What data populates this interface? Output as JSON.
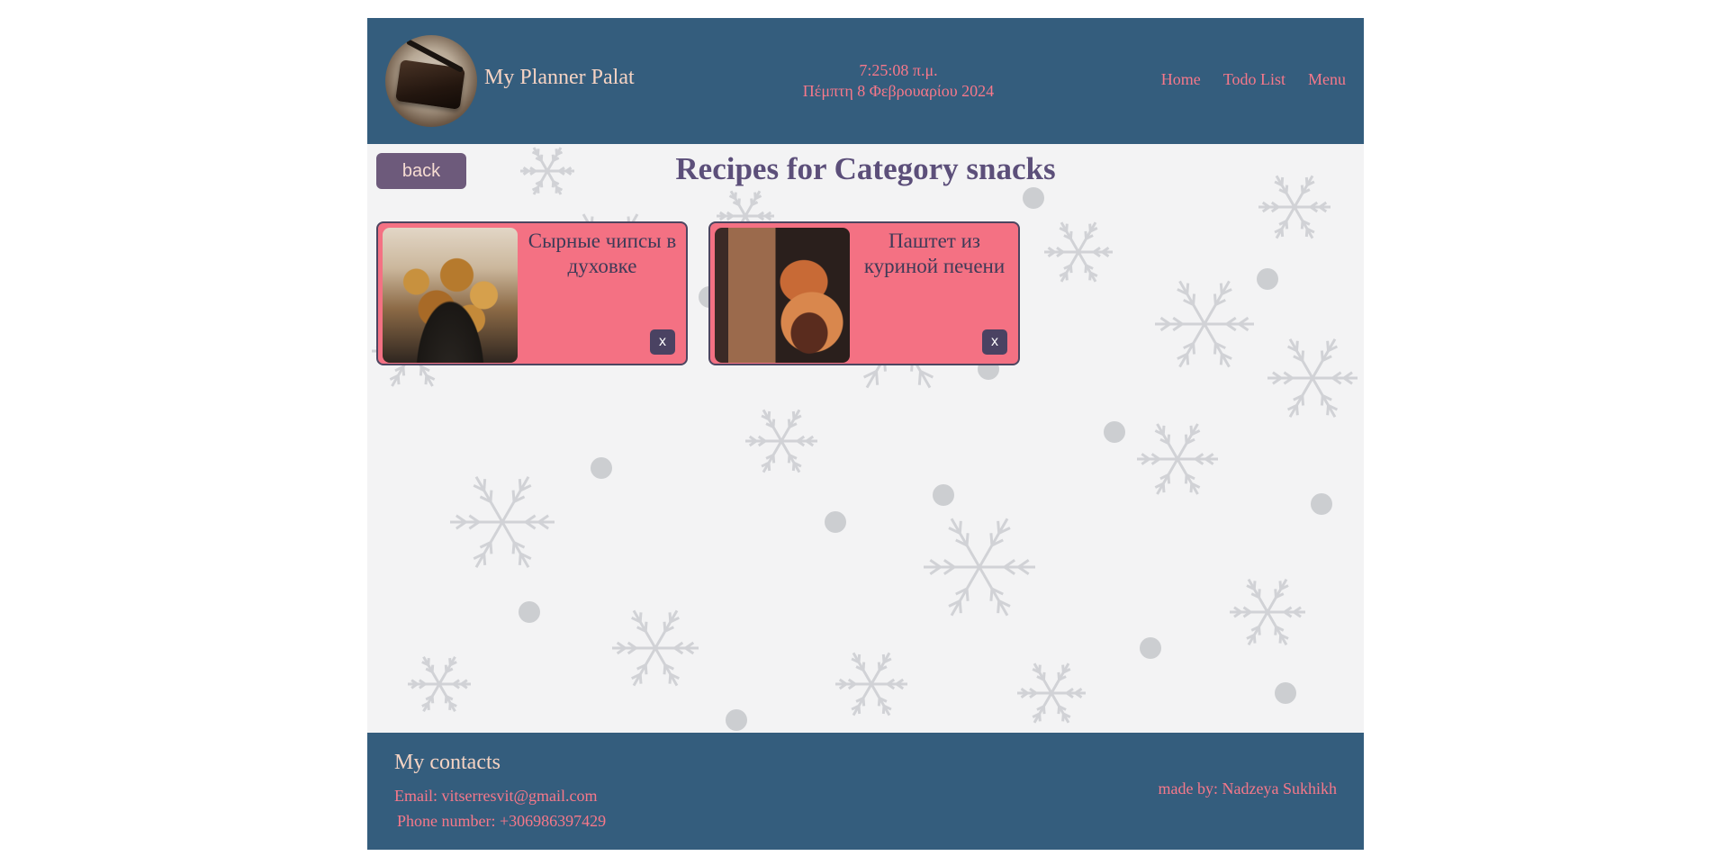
{
  "header": {
    "site_title": "My Planner Palat",
    "time": "7:25:08 π.μ.",
    "date": "Πέμπτη 8 Φεβρουαρίου 2024",
    "nav": [
      "Home",
      "Todo List",
      "Menu"
    ],
    "logo_icon": "planner-book-logo"
  },
  "main": {
    "back_label": "back",
    "title": "Recipes for Category snacks",
    "recipes": [
      {
        "name": "Сырные чипсы в духовке",
        "delete_label": "x",
        "image": "cheese-chips-photo"
      },
      {
        "name": "Паштет из куриной печени",
        "delete_label": "x",
        "image": "chicken-liver-pate-photo"
      }
    ]
  },
  "footer": {
    "contacts_title": "My contacts",
    "email": "Email: vitserresvit@gmail.com",
    "phone": "Phone number: +306986397429",
    "made_by": "made by: Nadzeya Sukhikh"
  },
  "colors": {
    "header_bg": "#345d7d",
    "accent_pink": "#f6788a",
    "card_bg": "#f47183",
    "button_purple": "#6d5a7b",
    "title_purple": "#5c4f7a"
  }
}
